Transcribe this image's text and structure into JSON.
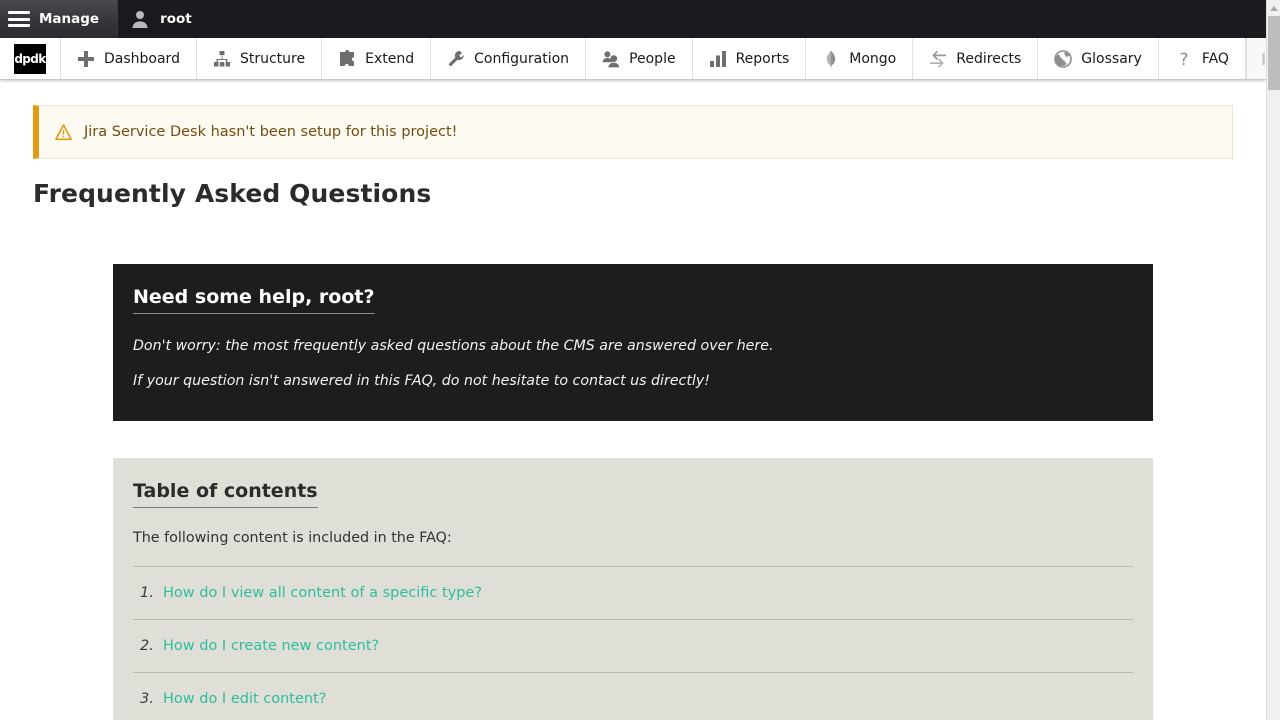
{
  "toolbar": {
    "manage_label": "Manage",
    "manage_icon": "hamburger-menu-icon",
    "user_label": "root",
    "user_icon": "user-avatar-icon"
  },
  "nav": {
    "logo_text": "dpdk",
    "items": [
      {
        "label": "Dashboard",
        "icon": "plus-icon"
      },
      {
        "label": "Structure",
        "icon": "sitemap-icon"
      },
      {
        "label": "Extend",
        "icon": "puzzle-piece-icon"
      },
      {
        "label": "Configuration",
        "icon": "wrench-icon"
      },
      {
        "label": "People",
        "icon": "people-icon"
      },
      {
        "label": "Reports",
        "icon": "bar-chart-icon"
      },
      {
        "label": "Mongo",
        "icon": "mongo-leaf-icon"
      },
      {
        "label": "Redirects",
        "icon": "swap-arrows-icon"
      },
      {
        "label": "Glossary",
        "icon": "globe-icon"
      },
      {
        "label": "FAQ",
        "icon": "question-mark-icon"
      }
    ],
    "collapse_icon": "collapse-toolbar-icon"
  },
  "message": {
    "icon": "warning-triangle-icon",
    "text": "Jira Service Desk hasn't been setup for this project!"
  },
  "page": {
    "title": "Frequently Asked Questions"
  },
  "help_panel": {
    "heading": "Need some help, root?",
    "paragraph1": "Don't worry: the most frequently asked questions about the CMS are answered over here.",
    "paragraph2": "If your question isn't answered in this FAQ, do not hesitate to contact us directly!"
  },
  "toc": {
    "heading": "Table of contents",
    "intro": "The following content is included in the FAQ:",
    "items": [
      {
        "number": "1.",
        "label": "How do I view all content of a specific type?"
      },
      {
        "number": "2.",
        "label": "How do I create new content?"
      },
      {
        "number": "3.",
        "label": "How do I edit content?"
      }
    ]
  },
  "scrollbar": {
    "up_arrow_icon": "scroll-up-arrow-icon"
  },
  "colors": {
    "toolbar_bg": "#1b1b1f",
    "help_panel_bg": "#1d1d20",
    "toc_panel_bg": "#dfdfd8",
    "link_teal": "#2fbd9e",
    "warning_border": "#e09c16",
    "warning_bg": "#fdfaf2",
    "warning_text": "#734c10"
  }
}
